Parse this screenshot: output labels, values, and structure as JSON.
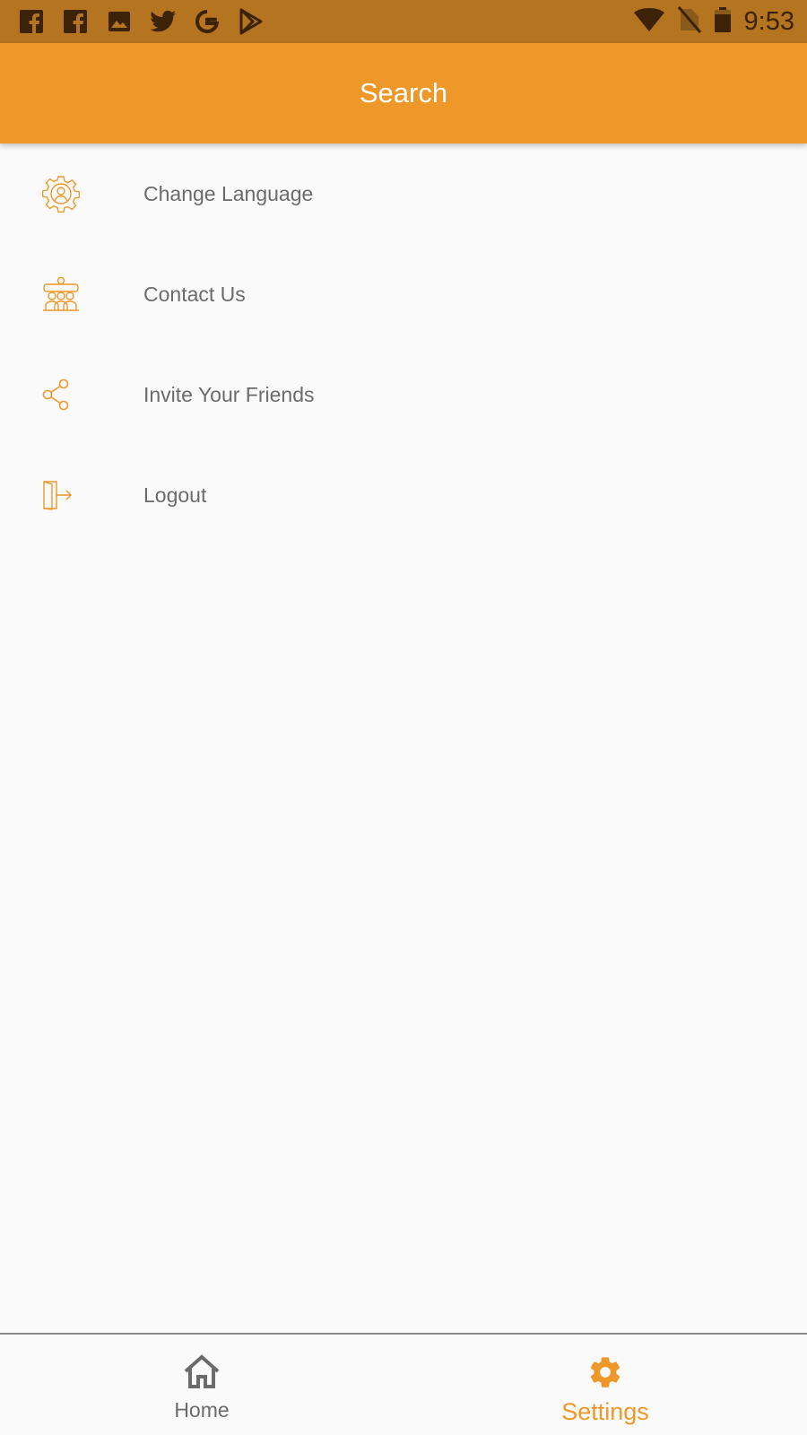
{
  "status_bar": {
    "time": "9:53",
    "notification_icons": [
      "facebook-icon",
      "facebook-icon",
      "image-icon",
      "twitter-icon",
      "google-icon",
      "play-store-icon"
    ],
    "system_icons": [
      "wifi-icon",
      "no-sim-icon",
      "battery-icon"
    ]
  },
  "app_bar": {
    "title": "Search"
  },
  "menu": {
    "items": [
      {
        "label": "Change Language",
        "icon": "settings-user-icon"
      },
      {
        "label": "Contact Us",
        "icon": "team-meeting-icon"
      },
      {
        "label": "Invite Your Friends",
        "icon": "share-icon"
      },
      {
        "label": "Logout",
        "icon": "logout-icon"
      }
    ]
  },
  "bottom_nav": {
    "tabs": [
      {
        "label": "Home",
        "icon": "home-icon",
        "active": false
      },
      {
        "label": "Settings",
        "icon": "gear-icon",
        "active": true
      }
    ]
  },
  "colors": {
    "accent": "#ee982a",
    "status_bar": "#b47420",
    "text_secondary": "#6b6b6b",
    "background": "#fafafa"
  }
}
